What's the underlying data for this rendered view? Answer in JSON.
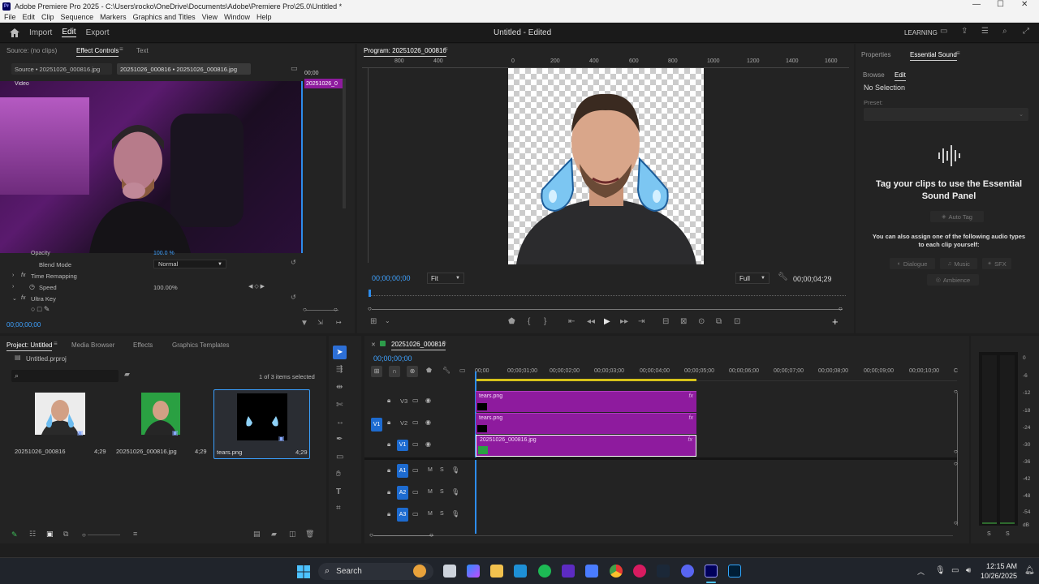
{
  "titlebar": {
    "title": "Adobe Premiere Pro 2025 - C:\\Users\\rocko\\OneDrive\\Documents\\Adobe\\Premiere Pro\\25.0\\Untitled *",
    "min": "—",
    "max": "☐",
    "close": "✕"
  },
  "menu": [
    "File",
    "Edit",
    "Clip",
    "Sequence",
    "Markers",
    "Graphics and Titles",
    "View",
    "Window",
    "Help"
  ],
  "appbar": {
    "import": "Import",
    "edit": "Edit",
    "export": "Export",
    "doc_title": "Untitled - Edited",
    "learning": "LEARNING"
  },
  "source": {
    "tab_source": "Source: (no clips)",
    "tab_effect_controls": "Effect Controls",
    "tab_text": "Text",
    "sub_source": "Source • 20251026_000816.jpg",
    "sub_clip": "20251026_000816 • 20251026_000816.jpg",
    "video_label": "Video",
    "time_start": "00;00",
    "clip_label": "20251026_0",
    "rows": {
      "opacity": "Opacity",
      "opacity_val": "100.0 %",
      "blend": "Blend Mode",
      "blend_val": "Normal",
      "time_remap": "Time Remapping",
      "speed": "Speed",
      "speed_val": "100.00%",
      "ultra_key": "Ultra Key"
    },
    "timecode": "00;00;00;00"
  },
  "program": {
    "title": "Program: 20251026_000816",
    "ruler": [
      "800",
      "400",
      "0",
      "200",
      "400",
      "600",
      "800",
      "1000",
      "1200",
      "1400",
      "1600"
    ],
    "timecode": "00;00;00;00",
    "fit": "Fit",
    "full": "Full",
    "duration": "00;00;04;29"
  },
  "essential": {
    "tab_properties": "Properties",
    "tab_essential": "Essential Sound",
    "browse": "Browse",
    "edit": "Edit",
    "no_selection": "No Selection",
    "preset": "Preset:",
    "heading": "Tag your clips to use the Essential Sound Panel",
    "auto_tag": "Auto Tag",
    "assign_text": "You can also assign one of the following audio types to each clip yourself:",
    "dialogue": "Dialogue",
    "music": "Music",
    "sfx": "SFX",
    "ambience": "Ambience"
  },
  "project": {
    "tab_project": "Project: Untitled",
    "tab_media": "Media Browser",
    "tab_effects": "Effects",
    "tab_graphics": "Graphics Templates",
    "file": "Untitled.prproj",
    "items_selected": "1 of 3 items selected",
    "items": [
      {
        "name": "20251026_000816",
        "dur": "4;29"
      },
      {
        "name": "20251026_000816.jpg",
        "dur": "4;29"
      },
      {
        "name": "tears.png",
        "dur": "4;29"
      }
    ]
  },
  "timeline": {
    "seq_name": "20251026_000816",
    "timecode": "00;00;00;00",
    "ruler": [
      "00;00",
      "00;00;01;00",
      "00;00;02;00",
      "00;00;03;00",
      "00;00;04;00",
      "00;00;05;00",
      "00;00;06;00",
      "00;00;07;00",
      "00;00;08;00",
      "00;00;09;00",
      "00;00;10;00",
      "C"
    ],
    "tracks_v": [
      "V3",
      "V2",
      "V1"
    ],
    "tracks_a": [
      "A1",
      "A2",
      "A3"
    ],
    "src_v": "V1",
    "m": "M",
    "s": "S",
    "clips": [
      {
        "name": "tears.png",
        "fx": "fx"
      },
      {
        "name": "tears.png",
        "fx": "fx"
      },
      {
        "name": "20251026_000816.jpg",
        "fx": "fx"
      }
    ]
  },
  "meter": {
    "scale": [
      "0",
      "-6",
      "-12",
      "-18",
      "-24",
      "-30",
      "-36",
      "-42",
      "-48",
      "-54",
      "dB"
    ],
    "s_left": "S",
    "s_right": "S"
  },
  "taskbar": {
    "search": "Search",
    "time": "12:15 AM",
    "date": "10/26/2025"
  },
  "colors": {
    "accent": "#2d8ceb",
    "clip": "#8e1b9e",
    "track_btn": "#1d6bd0"
  }
}
